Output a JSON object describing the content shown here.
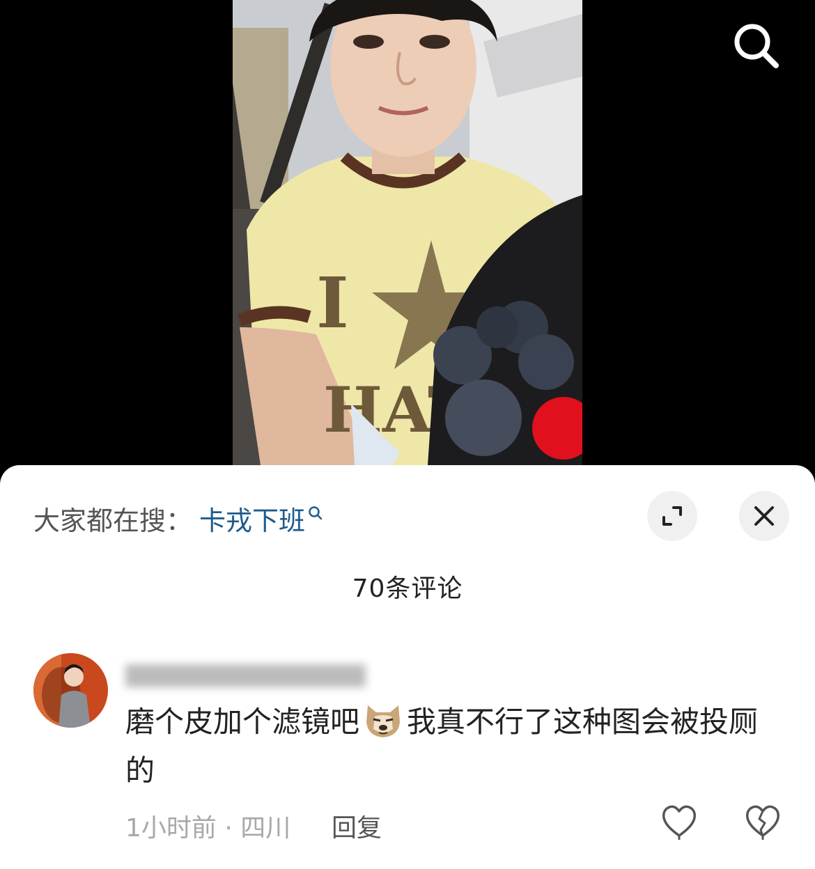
{
  "media": {
    "image": "video-frame-photo",
    "search_icon": "search-icon"
  },
  "sheet": {
    "hot_search_label": "大家都在搜：",
    "hot_search_term": "卡戎下班",
    "expand_icon": "expand-icon",
    "close_icon": "close-icon",
    "comment_count": "70条评论"
  },
  "comments": [
    {
      "text_part1": "磨个皮加个滤镜吧",
      "emoji": "dog-emoji",
      "text_part2": "我真不行了这种图会被投厕的",
      "time_location": "1小时前 · 四川",
      "reply_label": "回复",
      "like_icon": "heart-icon",
      "dislike_icon": "broken-heart-icon"
    }
  ],
  "colors": {
    "link": "#1e5b8c",
    "meta": "#a8a8a8",
    "sheet_bg": "#ffffff"
  }
}
